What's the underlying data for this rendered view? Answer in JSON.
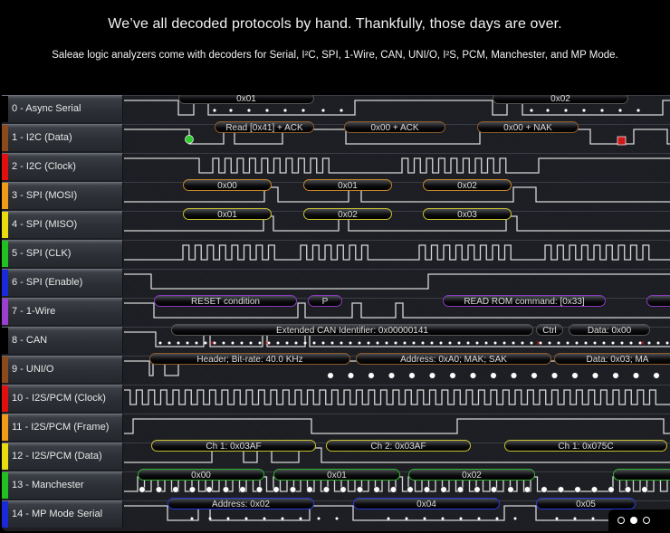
{
  "hero": {
    "headline": "We’ve all decoded protocols by hand.  Thankfully, those days are over.",
    "subline": "Saleae logic analyzers come with decoders for Serial, I²C, SPI, 1-Wire, CAN, UNI/O, I²S, PCM, Manchester, and MP Mode."
  },
  "channels": [
    {
      "label": "0 - Async Serial",
      "color": "#000000",
      "pill_color": "#555555",
      "annotations": [
        "0x01",
        "0x02"
      ]
    },
    {
      "label": "1 - I2C (Data)",
      "color": "#8b4a1c",
      "pill_color": "#8b5a2b",
      "annotations": [
        "Read [0x41] + ACK",
        "0x00 + ACK",
        "0x00 + NAK"
      ],
      "markers": [
        "start-green",
        "stop-red"
      ]
    },
    {
      "label": "2 - I2C (Clock)",
      "color": "#e01010",
      "annotations": []
    },
    {
      "label": "3 - SPI (MOSI)",
      "color": "#f09a1a",
      "pill_color": "#c8862a",
      "annotations": [
        "0x00",
        "0x01",
        "0x02"
      ]
    },
    {
      "label": "4 - SPI (MISO)",
      "color": "#e8dc10",
      "pill_color": "#c8c030",
      "annotations": [
        "0x01",
        "0x02",
        "0x03"
      ]
    },
    {
      "label": "5 - SPI (CLK)",
      "color": "#20c020",
      "annotations": []
    },
    {
      "label": "6 - SPI (Enable)",
      "color": "#1a2ad8",
      "annotations": []
    },
    {
      "label": "7 - 1-Wire",
      "color": "#9a40d0",
      "pill_color": "#8a3ac0",
      "annotations": [
        "RESET condition",
        "P",
        "READ ROM command: [0x33]",
        ""
      ]
    },
    {
      "label": "8 - CAN",
      "color": "#000000",
      "pill_color": "#555555",
      "annotations": [
        "Extended CAN Identifier: 0x00000141",
        "Ctrl",
        "Data: 0x00"
      ]
    },
    {
      "label": "9 - UNI/O",
      "color": "#8b4a1c",
      "pill_color": "#8b5a2b",
      "annotations": [
        "Header; Bit-rate: 40.0 KHz",
        "Address: 0xA0; MAK; SAK",
        "Data: 0x03; MA"
      ]
    },
    {
      "label": "10 - I2S/PCM (Clock)",
      "color": "#e01010",
      "annotations": []
    },
    {
      "label": "11 - I2S/PCM (Frame)",
      "color": "#f09a1a",
      "annotations": []
    },
    {
      "label": "12 - I2S/PCM (Data)",
      "color": "#e8dc10",
      "pill_color": "#c8c030",
      "annotations": [
        "Ch 1: 0x03AF",
        "Ch 2: 0x03AF",
        "Ch 1: 0x075C"
      ]
    },
    {
      "label": "13 - Manchester",
      "color": "#20c020",
      "pill_color": "#30b030",
      "annotations": [
        "0x00",
        "0x01",
        "0x02",
        ""
      ]
    },
    {
      "label": "14 - MP Mode Serial",
      "color": "#1a2ad8",
      "pill_color": "#2a3ad8",
      "annotations": [
        "Address: 0x02",
        "0x04",
        "0x05"
      ]
    }
  ],
  "carousel": {
    "slides": 3,
    "active": 2
  }
}
